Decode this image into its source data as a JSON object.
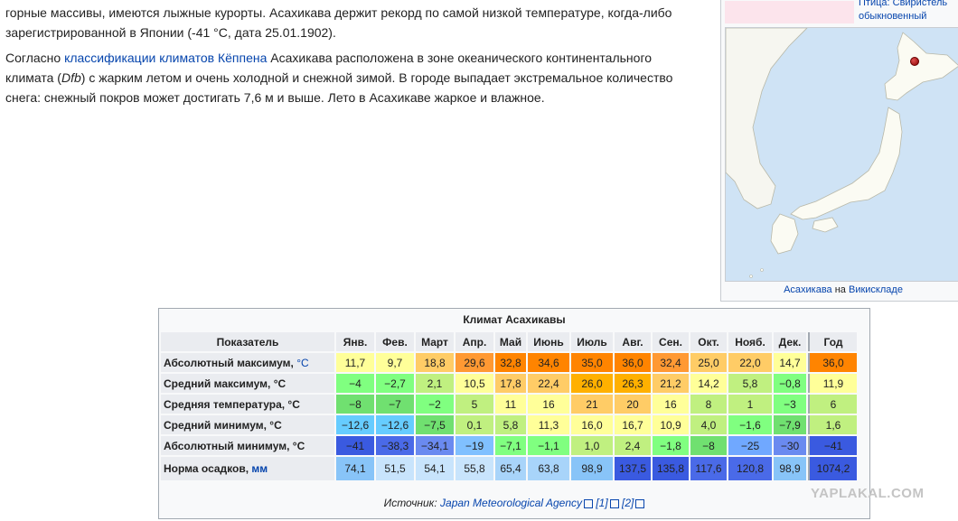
{
  "article": {
    "para1": "горные массивы, имеются лыжные курорты. Асахикава держит рекорд по самой низкой температуре, когда-либо зарегистрированной в Японии (-41 °C, дата 25.01.1902).",
    "para2_before": "Согласно ",
    "para2_link": "классификации климатов Кёппена",
    "para2_mid": " Асахикава расположена в зоне океанического континентального климата (",
    "para2_dfb": "Dfb",
    "para2_after": ") с жарким летом и очень холодной и снежной зимой. В городе выпадает экстремальное количество снега: снежный покров может достигать 7,6 м и выше. Лето в Асахикаве жаркое и влажное."
  },
  "infobox": {
    "bird_line1": "Птица: Свиристель",
    "bird_line2": "обыкновенный",
    "caption_link": "Асахикава",
    "caption_mid": " на ",
    "caption_link2": "Викискладе"
  },
  "climate": {
    "title": "Климат Асахикавы",
    "header_label": "Показатель",
    "months": [
      "Янв.",
      "Фев.",
      "Март",
      "Апр.",
      "Май",
      "Июнь",
      "Июль",
      "Авг.",
      "Сен.",
      "Окт.",
      "Нояб.",
      "Дек."
    ],
    "year_label": "Год",
    "rows": [
      {
        "label": "Абсолютный максимум, ",
        "unit": "°C",
        "unit_link": true,
        "values": [
          "11,7",
          "9,7",
          "18,8",
          "29,6",
          "32,8",
          "34,6",
          "35,0",
          "36,0",
          "32,4",
          "25,0",
          "22,0",
          "14,7"
        ],
        "year": "36,0",
        "colors": [
          "#ffff99",
          "#ffff99",
          "#ffcc66",
          "#ff9933",
          "#ff8400",
          "#ff8400",
          "#ff8400",
          "#ff8400",
          "#ff9933",
          "#ffcc66",
          "#ffcc66",
          "#ffff99"
        ],
        "year_color": "#ff8400"
      },
      {
        "label": "Средний максимум, °C",
        "unit": "",
        "unit_link": false,
        "values": [
          "−4",
          "−2,7",
          "2,1",
          "10,5",
          "17,8",
          "22,4",
          "26,0",
          "26,3",
          "21,2",
          "14,2",
          "5,8",
          "−0,8"
        ],
        "year": "11,9",
        "colors": [
          "#80ff80",
          "#80ff80",
          "#c0f080",
          "#ffff99",
          "#ffcc66",
          "#ffcc66",
          "#ffb000",
          "#ffb000",
          "#ffcc66",
          "#ffff99",
          "#c0f080",
          "#80ff80"
        ],
        "year_color": "#ffff99"
      },
      {
        "label": "Средняя температура, °C",
        "unit": "",
        "unit_link": false,
        "values": [
          "−8",
          "−7",
          "−2",
          "5",
          "11",
          "16",
          "21",
          "20",
          "16",
          "8",
          "1",
          "−3"
        ],
        "year": "6",
        "colors": [
          "#70e070",
          "#70e070",
          "#80ff80",
          "#c0f080",
          "#ffff99",
          "#ffff99",
          "#ffcc66",
          "#ffcc66",
          "#ffff99",
          "#c0f080",
          "#c0f080",
          "#80ff80"
        ],
        "year_color": "#c0f080"
      },
      {
        "label": "Средний минимум, °C",
        "unit": "",
        "unit_link": false,
        "values": [
          "−12,6",
          "−12,6",
          "−7,5",
          "0,1",
          "5,8",
          "11,3",
          "16,0",
          "16,7",
          "10,9",
          "4,0",
          "−1,6",
          "−7,9"
        ],
        "year": "1,6",
        "colors": [
          "#66ccff",
          "#66ccff",
          "#70e070",
          "#c0f080",
          "#c0f080",
          "#ffff99",
          "#ffff99",
          "#ffff99",
          "#ffff99",
          "#c0f080",
          "#80ff80",
          "#70e070"
        ],
        "year_color": "#c0f080"
      },
      {
        "label": "Абсолютный минимум, °C",
        "unit": "",
        "unit_link": false,
        "values": [
          "−41",
          "−38,3",
          "−34,1",
          "−19",
          "−7,1",
          "−1,1",
          "1,0",
          "2,4",
          "−1,8",
          "−8",
          "−25",
          "−30"
        ],
        "year": "−41",
        "colors": [
          "#3a5ae0",
          "#4a6ae8",
          "#6a8af0",
          "#80c0ff",
          "#80ff80",
          "#80ff80",
          "#c0f080",
          "#c0f080",
          "#80ff80",
          "#70e070",
          "#70a8ff",
          "#6a8af0"
        ],
        "year_color": "#3a5ae0"
      }
    ],
    "precip": {
      "label": "Норма осадков, ",
      "unit": "мм",
      "values": [
        "74,1",
        "51,5",
        "54,1",
        "55,8",
        "65,4",
        "63,8",
        "98,9",
        "137,5",
        "135,8",
        "117,6",
        "120,8",
        "98,9"
      ],
      "year": "1074,2",
      "colors": [
        "#88c4f8",
        "#c8e4fc",
        "#c8e4fc",
        "#c8e4fc",
        "#a8d4fa",
        "#a8d4fa",
        "#88c4f8",
        "#3a5ae0",
        "#3a5ae0",
        "#4a6ae8",
        "#4a6ae8",
        "#88c4f8"
      ],
      "year_color": "#3a5ae0"
    },
    "source_prefix": "Источник: ",
    "source_link": "Japan Meteorological Agency",
    "ref1": "[1]",
    "ref2": "[2]"
  },
  "watermark": "YAPLAKAL.COM"
}
